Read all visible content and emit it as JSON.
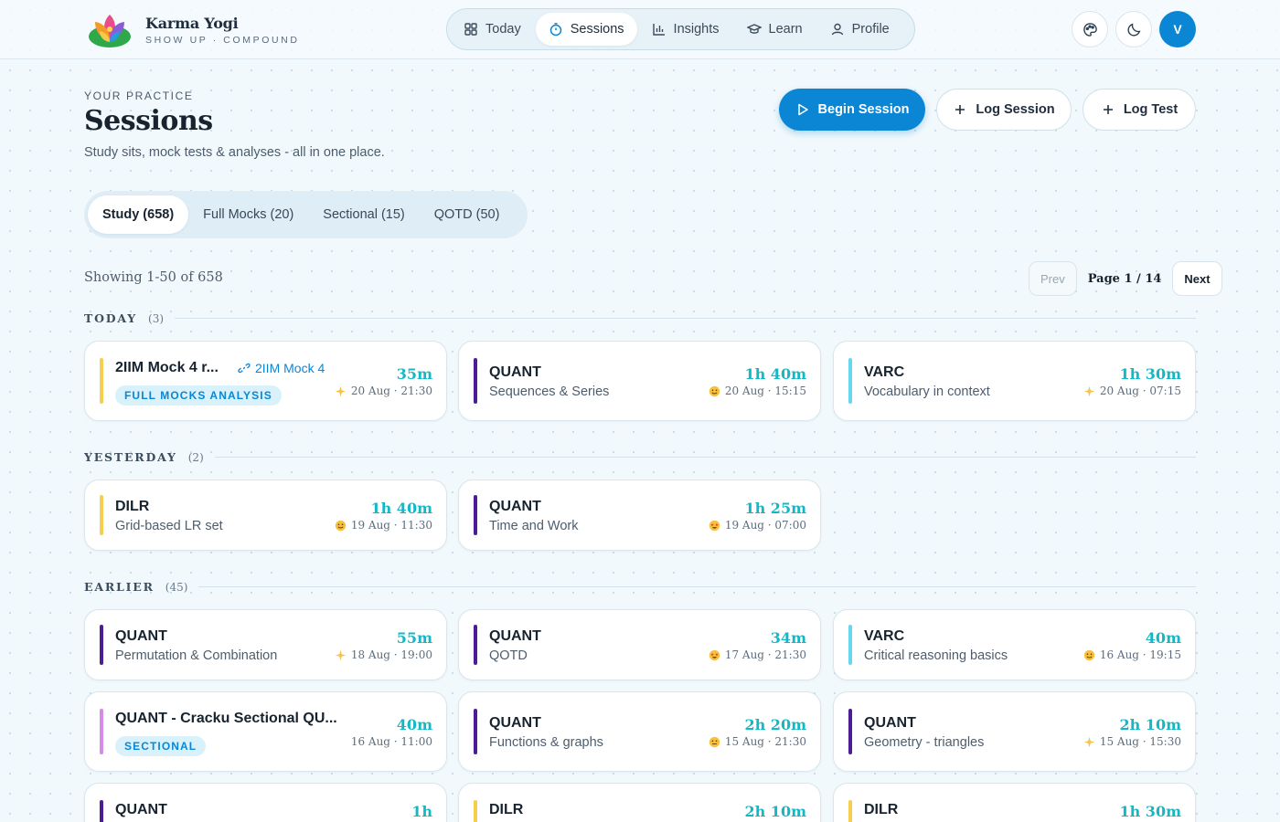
{
  "brand": {
    "name": "Karma Yogi",
    "tagline": "SHOW UP · COMPOUND"
  },
  "nav": [
    {
      "label": "Today",
      "icon": "grid-icon",
      "active": false
    },
    {
      "label": "Sessions",
      "icon": "timer-icon",
      "active": true
    },
    {
      "label": "Insights",
      "icon": "bar-chart-icon",
      "active": false
    },
    {
      "label": "Learn",
      "icon": "graduation-cap-icon",
      "active": false
    },
    {
      "label": "Profile",
      "icon": "user-icon",
      "active": false
    }
  ],
  "header": {
    "avatar_initial": "V",
    "palette_icon": "palette-icon",
    "theme_icon": "moon-icon"
  },
  "page": {
    "eyebrow": "YOUR PRACTICE",
    "title": "Sessions",
    "subtitle": "Study sits, mock tests & analyses - all in one place."
  },
  "actions": {
    "begin": "Begin Session",
    "log_session": "Log Session",
    "log_test": "Log Test"
  },
  "tabs": [
    "Study (658)",
    "Full Mocks (20)",
    "Sectional (15)",
    "QOTD (50)"
  ],
  "pagination": {
    "showing": "Showing 1-50 of 658",
    "prev": "Prev",
    "page": "Page 1 / 14",
    "next": "Next"
  },
  "colors": {
    "accent": "#0a86d4",
    "duration": "#14b8c4",
    "quant": "#4c1d95",
    "dilr": "#f6cf4f",
    "varc": "#67d7f0",
    "mock": "#f6cf4f",
    "sectional": "#d58be8"
  },
  "groups": [
    {
      "name": "TODAY",
      "count": "(3)"
    },
    {
      "name": "YESTERDAY",
      "count": "(2)"
    },
    {
      "name": "EARLIER",
      "count": "(45)"
    }
  ],
  "cards": [
    {
      "title": "2IIM Mock 4 r...",
      "link": "2IIM Mock 4",
      "badge": "FULL MOCKS ANALYSIS",
      "duration": "35m",
      "mood": "sparkle",
      "meta": "20 Aug · 21:30"
    },
    {
      "title": "QUANT",
      "sub": "Sequences & Series",
      "duration": "1h 40m",
      "mood": "smile",
      "meta": "20 Aug · 15:15"
    },
    {
      "title": "VARC",
      "sub": "Vocabulary in context",
      "duration": "1h 30m",
      "mood": "sparkle",
      "meta": "20 Aug · 07:15"
    },
    {
      "title": "DILR",
      "sub": "Grid-based LR set",
      "duration": "1h 40m",
      "mood": "smile",
      "meta": "19 Aug · 11:30"
    },
    {
      "title": "QUANT",
      "sub": "Time and Work",
      "duration": "1h 25m",
      "mood": "starstruck",
      "meta": "19 Aug · 07:00"
    },
    {
      "title": "QUANT",
      "sub": "Permutation & Combination",
      "duration": "55m",
      "mood": "sparkle",
      "meta": "18 Aug · 19:00"
    },
    {
      "title": "QUANT",
      "sub": "QOTD",
      "duration": "34m",
      "mood": "starstruck",
      "meta": "17 Aug · 21:30"
    },
    {
      "title": "VARC",
      "sub": "Critical reasoning basics",
      "duration": "40m",
      "mood": "smile",
      "meta": "16 Aug · 19:15"
    },
    {
      "title": "QUANT - Cracku Sectional QU...",
      "badge": "SECTIONAL",
      "duration": "40m",
      "meta": "16 Aug · 11:00"
    },
    {
      "title": "QUANT",
      "sub": "Functions & graphs",
      "duration": "2h 20m",
      "mood": "neutral",
      "meta": "15 Aug · 21:30"
    },
    {
      "title": "QUANT",
      "sub": "Geometry - triangles",
      "duration": "2h 10m",
      "mood": "sparkle",
      "meta": "15 Aug · 15:30"
    },
    {
      "title": "QUANT",
      "duration": "1h"
    },
    {
      "title": "DILR",
      "duration": "2h 10m"
    },
    {
      "title": "DILR",
      "duration": "1h 30m"
    }
  ]
}
